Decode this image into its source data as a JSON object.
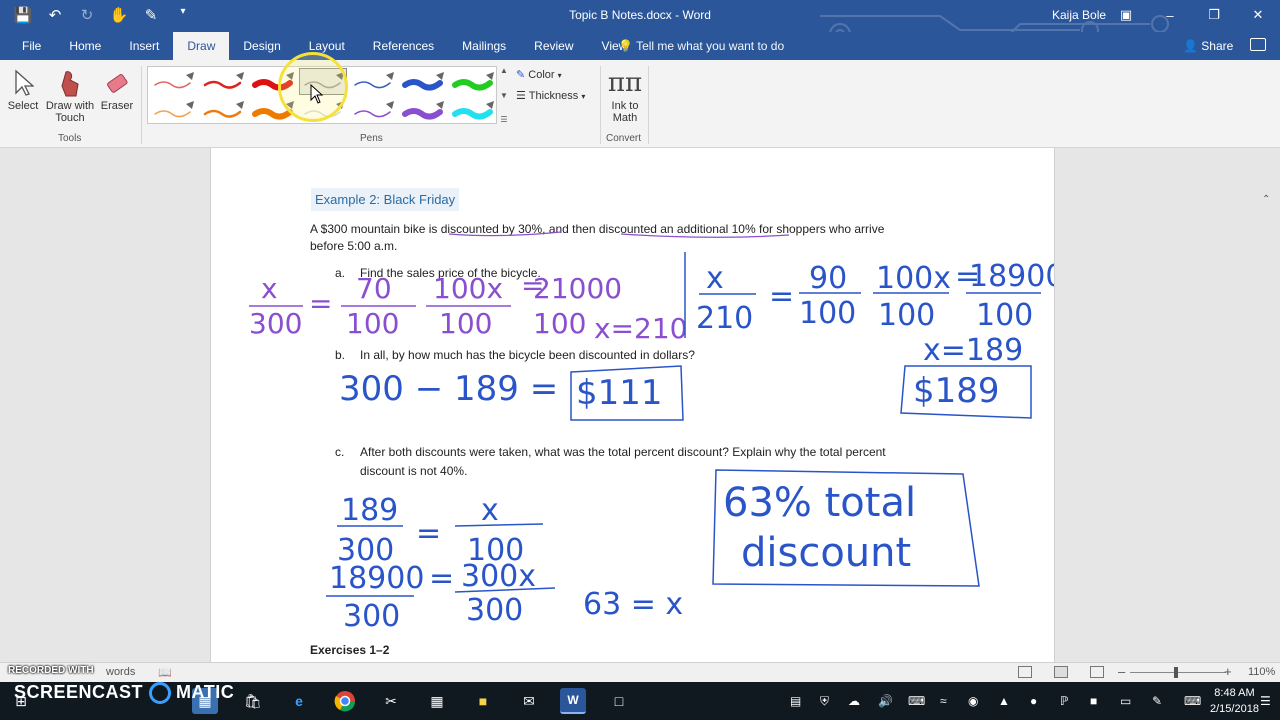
{
  "window": {
    "title": "Topic B Notes.docx - Word",
    "user": "Kaija Bole"
  },
  "tabs": [
    "File",
    "Home",
    "Insert",
    "Draw",
    "Design",
    "Layout",
    "References",
    "Mailings",
    "Review",
    "View"
  ],
  "active_tab": "Draw",
  "tell_me": "Tell me what you want to do",
  "share": "Share",
  "ribbon": {
    "tools": {
      "select": "Select",
      "draw_with_touch_1": "Draw with",
      "draw_with_touch_2": "Touch",
      "eraser": "Eraser",
      "group": "Tools"
    },
    "pens": {
      "group": "Pens",
      "colors_row1": [
        "#e06666",
        "#dd2222",
        "#dd1111",
        "#9a9a9a",
        "#3b5fc0",
        "#2a55c8",
        "#22cc22"
      ],
      "colors_row2": [
        "#f0a050",
        "#ee7a10",
        "#ee7a00",
        "#d8d8d8",
        "#8a4fd0",
        "#8a4fd0",
        "#22e0ee"
      ],
      "selected_index": 3
    },
    "color_label": "Color",
    "thickness_label": "Thickness",
    "convert": {
      "ink_to_math_1": "Ink to",
      "ink_to_math_2": "Math",
      "group": "Convert"
    }
  },
  "document": {
    "heading": "Example 2:  Black Friday",
    "problem_line1": "A $300 mountain bike is discounted by 30%, and then discounted an additional 10% for shoppers who arrive",
    "problem_line2": "before 5:00 a.m.",
    "a_label": "a.",
    "a_text": "Find the sales price of the bicycle.",
    "b_label": "b.",
    "b_text": "In all, by how much has the bicycle been discounted in dollars?",
    "c_label": "c.",
    "c_text1": "After both discounts were taken, what was the total percent discount? Explain why the total percent",
    "c_text2": "discount is not 40%.",
    "exercises": "Exercises 1–2"
  },
  "ink": {
    "eq1": [
      "x",
      "300",
      "=",
      "70",
      "100",
      "100x",
      "100",
      "=",
      "21000",
      "100",
      "x=210"
    ],
    "eq2": [
      "x",
      "210",
      "=",
      "90",
      "100",
      "100x",
      "100",
      "=",
      "18900",
      "100",
      "x=189"
    ],
    "boxed_a": "$189",
    "b_work": "300 − 189 =",
    "boxed_b": "$111",
    "c_work_1": [
      "189",
      "300",
      "=",
      "x",
      "100"
    ],
    "c_work_2": [
      "18900",
      "300",
      "=",
      "300x",
      "300"
    ],
    "c_result": "63 = x",
    "boxed_c_1": "63% total",
    "boxed_c_2": "discount"
  },
  "status": {
    "recorded": "RECORDED WITH",
    "words": "words",
    "zoom": "110%"
  },
  "taskbar": {
    "screencast": "SCREENCAST",
    "matic": "MATIC",
    "time": "8:48 AM",
    "date": "2/15/2018"
  }
}
